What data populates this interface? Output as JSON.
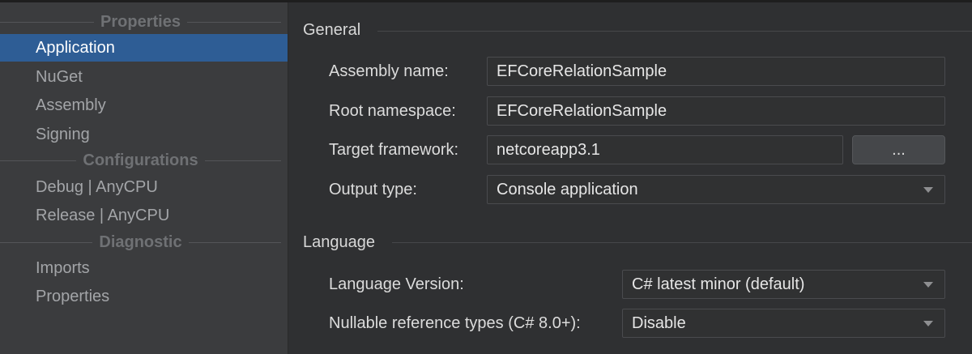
{
  "sidebar": {
    "groups": [
      {
        "title": "Properties",
        "items": [
          "Application",
          "NuGet",
          "Assembly",
          "Signing"
        ]
      },
      {
        "title": "Configurations",
        "items": [
          "Debug | AnyCPU",
          "Release | AnyCPU"
        ]
      },
      {
        "title": "Diagnostic",
        "items": [
          "Imports",
          "Properties"
        ]
      }
    ],
    "selected": "Application"
  },
  "general": {
    "title": "General",
    "assembly_name": {
      "label": "Assembly name:",
      "value": "EFCoreRelationSample"
    },
    "root_namespace": {
      "label": "Root namespace:",
      "value": "EFCoreRelationSample"
    },
    "target_framework": {
      "label": "Target framework:",
      "value": "netcoreapp3.1",
      "button": "..."
    },
    "output_type": {
      "label": "Output type:",
      "value": "Console application"
    }
  },
  "language": {
    "title": "Language",
    "language_version": {
      "label": "Language Version:",
      "value": "C# latest minor (default)"
    },
    "nullable": {
      "label": "Nullable reference types (C# 8.0+):",
      "value": "Disable"
    }
  },
  "colors": {
    "selection": "#2e5d95",
    "sidebar_bg": "#3b3c3e",
    "panel_bg": "#2f3032"
  }
}
